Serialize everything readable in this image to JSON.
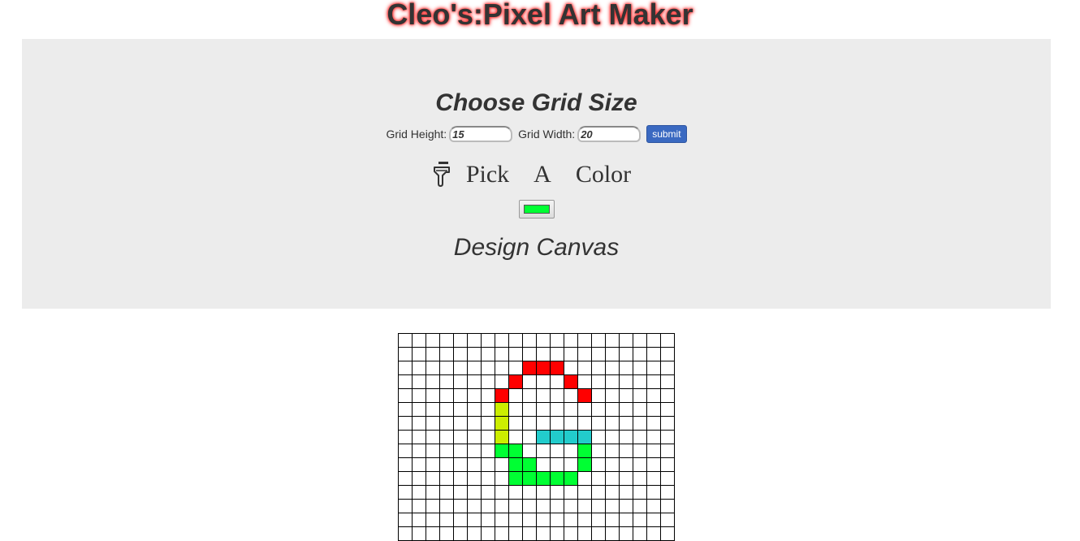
{
  "header": {
    "title": "Cleo's:Pixel Art Maker"
  },
  "grid_size": {
    "heading": "Choose Grid Size",
    "height_label": "Grid Height:",
    "height_value": "15",
    "width_label": "Grid Width:",
    "width_value": "20",
    "submit_label": "submit"
  },
  "color_picker": {
    "heading_words": [
      "Pick",
      "A",
      "Color"
    ],
    "icon": "paint-brush-icon",
    "selected_color": "#00ff33"
  },
  "canvas": {
    "heading": "Design Canvas",
    "rows": 15,
    "cols": 20,
    "painted_cells": [
      {
        "row": 2,
        "col": 9,
        "color": "#ff0000"
      },
      {
        "row": 2,
        "col": 10,
        "color": "#ff0000"
      },
      {
        "row": 2,
        "col": 11,
        "color": "#ff0000"
      },
      {
        "row": 3,
        "col": 8,
        "color": "#ff0000"
      },
      {
        "row": 3,
        "col": 12,
        "color": "#ff0000"
      },
      {
        "row": 4,
        "col": 7,
        "color": "#ff0000"
      },
      {
        "row": 4,
        "col": 13,
        "color": "#ff0000"
      },
      {
        "row": 5,
        "col": 7,
        "color": "#ccee00"
      },
      {
        "row": 6,
        "col": 7,
        "color": "#ccee00"
      },
      {
        "row": 7,
        "col": 7,
        "color": "#ccee00"
      },
      {
        "row": 7,
        "col": 10,
        "color": "#22cccc"
      },
      {
        "row": 7,
        "col": 11,
        "color": "#22cccc"
      },
      {
        "row": 7,
        "col": 12,
        "color": "#22cccc"
      },
      {
        "row": 7,
        "col": 13,
        "color": "#22cccc"
      },
      {
        "row": 8,
        "col": 7,
        "color": "#00ff33"
      },
      {
        "row": 8,
        "col": 8,
        "color": "#00ff33"
      },
      {
        "row": 8,
        "col": 13,
        "color": "#00ff33"
      },
      {
        "row": 9,
        "col": 8,
        "color": "#00ff33"
      },
      {
        "row": 9,
        "col": 9,
        "color": "#00ff33"
      },
      {
        "row": 9,
        "col": 13,
        "color": "#00ff33"
      },
      {
        "row": 10,
        "col": 8,
        "color": "#00ff33"
      },
      {
        "row": 10,
        "col": 9,
        "color": "#00ff33"
      },
      {
        "row": 10,
        "col": 10,
        "color": "#00ff33"
      },
      {
        "row": 10,
        "col": 11,
        "color": "#00ff33"
      },
      {
        "row": 10,
        "col": 12,
        "color": "#00ff33"
      }
    ]
  }
}
